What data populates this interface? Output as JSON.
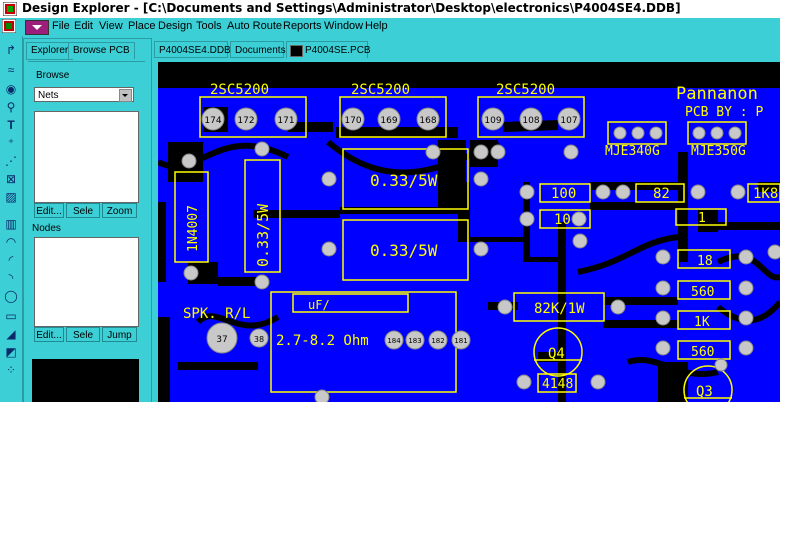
{
  "window": {
    "title": "Design Explorer - [C:\\Documents and Settings\\Administrator\\Desktop\\electronics\\P4004SE4.DDB]"
  },
  "menu": [
    "File",
    "Edit",
    "View",
    "Place",
    "Design",
    "Tools",
    "Auto Route",
    "Reports",
    "Window",
    "Help"
  ],
  "explorer": {
    "tabs": [
      "Explorer",
      "Browse PCB"
    ],
    "browse_label": "Browse",
    "browse_select": "Nets",
    "browse_buttons": [
      "Edit...",
      "Sele",
      "Zoom"
    ],
    "nodes_label": "Nodes",
    "nodes_buttons": [
      "Edit...",
      "Sele",
      "Jump"
    ]
  },
  "doc_tabs": [
    "P4004SE4.DDB",
    "Documents",
    "P4004SE.PCB"
  ],
  "pcb": {
    "colors": {
      "board": "#0000ff",
      "silk": "#ffff00",
      "pad": "#c8c8c8",
      "bg": "#000000"
    },
    "labels": {
      "t1": "2SC5200",
      "t2": "2SC5200",
      "t3": "2SC5200",
      "p174": "174",
      "p172": "172",
      "p171": "171",
      "p170": "170",
      "p169": "169",
      "p168": "168",
      "p109": "109",
      "p108": "108",
      "p107": "107",
      "mje340": "MJE340G",
      "mje350": "MJE350G",
      "brand1": "Pannanon",
      "brand2": "PCB BY : P",
      "r100": "100",
      "r82": "82",
      "r1k8": "1K8",
      "r10": "10",
      "r1ba": "1 ",
      "r033a": "0.33/5W",
      "r033b": "0.33/5W",
      "r033v": "0.33/5W",
      "d1n4007": "1N4007",
      "spk": "SPK. R/L",
      "p37": "37",
      "p38": "38",
      "ohm": "2.7-8.2 Ohm",
      "p184": "184",
      "p183": "183",
      "p182": "182",
      "p181": "181",
      "cap": "   uF/    ",
      "r82k": "82K/1W",
      "q4": "Q4",
      "q3": "Q3",
      "d4148": "4148",
      "r18": "18",
      "r560a": "560",
      "r1k": "1K",
      "r560b": "560"
    }
  }
}
